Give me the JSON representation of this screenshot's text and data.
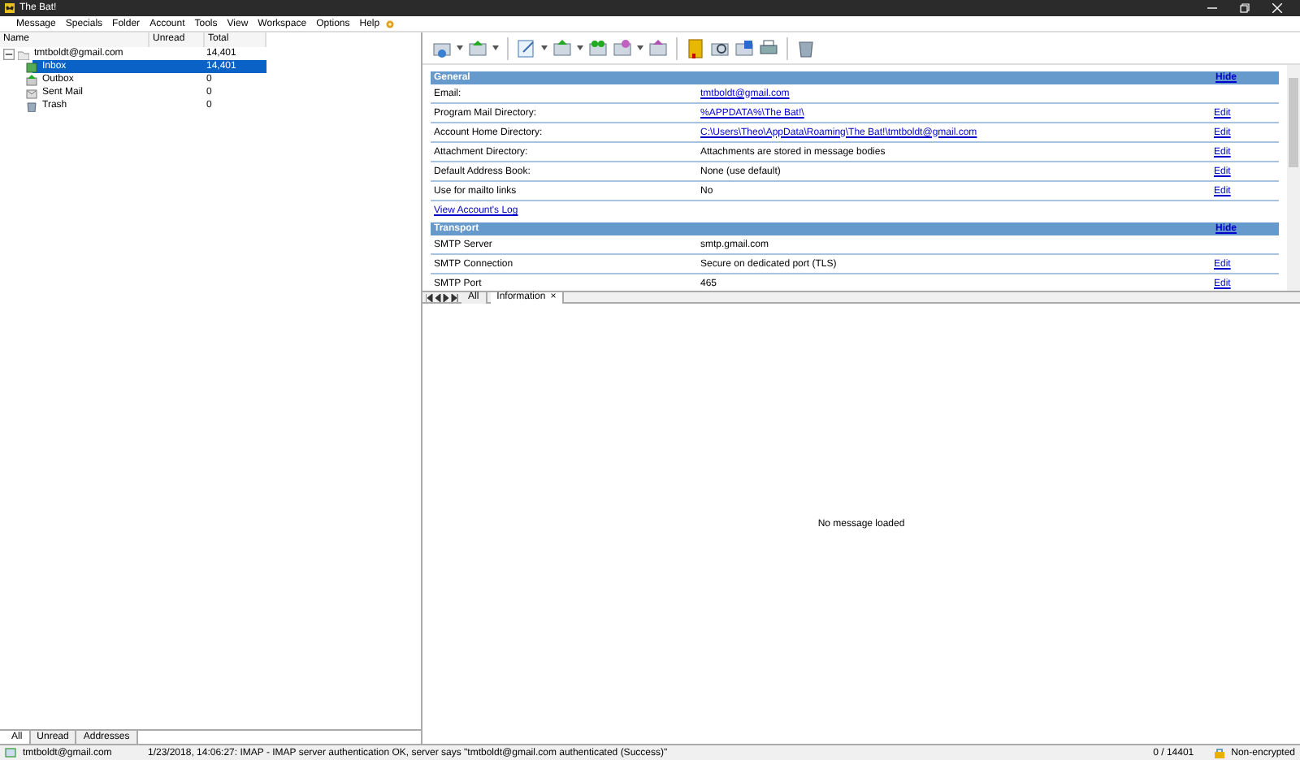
{
  "window": {
    "title": "The Bat!"
  },
  "menu": [
    "Message",
    "Specials",
    "Folder",
    "Account",
    "Tools",
    "View",
    "Workspace",
    "Options",
    "Help"
  ],
  "folder_tree": {
    "columns": [
      "Name",
      "Unread",
      "Total"
    ],
    "items": [
      {
        "name": "tmtboldt@gmail.com",
        "total": "14,401",
        "expanded": true,
        "selected": false,
        "kind": "account",
        "children": [
          {
            "name": "Inbox",
            "total": "14,401",
            "selected": true,
            "kind": "inbox"
          },
          {
            "name": "Outbox",
            "total": "0",
            "selected": false,
            "kind": "outbox"
          },
          {
            "name": "Sent Mail",
            "total": "0",
            "selected": false,
            "kind": "sent"
          },
          {
            "name": "Trash",
            "total": "0",
            "selected": false,
            "kind": "trash"
          }
        ]
      }
    ]
  },
  "folder_tabs": [
    {
      "label": "All",
      "selected": true
    },
    {
      "label": "Unread",
      "selected": false
    },
    {
      "label": "Addresses",
      "selected": false
    }
  ],
  "info_sections": [
    {
      "title": "General",
      "action": "Hide",
      "rows": [
        {
          "kind": "field",
          "label": "Email:",
          "value": "tmtboldt@gmail.com",
          "link": true
        },
        {
          "kind": "field",
          "label": "Program Mail Directory:",
          "value": "%APPDATA%\\The Bat!\\",
          "link": true,
          "action": "Edit"
        },
        {
          "kind": "field",
          "label": "Account Home Directory:",
          "value": "C:\\Users\\Theo\\AppData\\Roaming\\The Bat!\\tmtboldt@gmail.com",
          "link": true,
          "action": "Edit"
        },
        {
          "kind": "field",
          "label": "Attachment Directory:",
          "value": "Attachments are stored in message bodies",
          "link": false,
          "action": "Edit"
        },
        {
          "kind": "field",
          "label": "Default Address Book:",
          "value": "None (use default)",
          "link": false,
          "action": "Edit"
        },
        {
          "kind": "field",
          "label": "Use for mailto links",
          "value": "No",
          "link": false,
          "action": "Edit"
        },
        {
          "kind": "link",
          "label": "View Account's Log"
        }
      ]
    },
    {
      "title": "Transport",
      "action": "Hide",
      "rows": [
        {
          "kind": "field",
          "label": "SMTP Server",
          "value": "smtp.gmail.com",
          "link": false
        },
        {
          "kind": "field",
          "label": "SMTP Connection",
          "value": "Secure on dedicated port (TLS)",
          "link": false,
          "action": "Edit"
        },
        {
          "kind": "field",
          "label": "SMTP Port",
          "value": "465",
          "link": false,
          "action": "Edit"
        }
      ]
    }
  ],
  "view_tabs": [
    {
      "label": "All",
      "selected": false,
      "closable": false
    },
    {
      "label": "Information",
      "selected": true,
      "closable": true,
      "close": "×"
    }
  ],
  "message_pane": {
    "text": "No message loaded"
  },
  "status_bar": {
    "account": "tmtboldt@gmail.com",
    "log": "1/23/2018, 14:06:27: IMAP  - IMAP server authentication OK, server says \"tmtboldt@gmail.com authenticated (Success)\"",
    "count": "0 / 14401",
    "encryption": "Non-encrypted"
  }
}
